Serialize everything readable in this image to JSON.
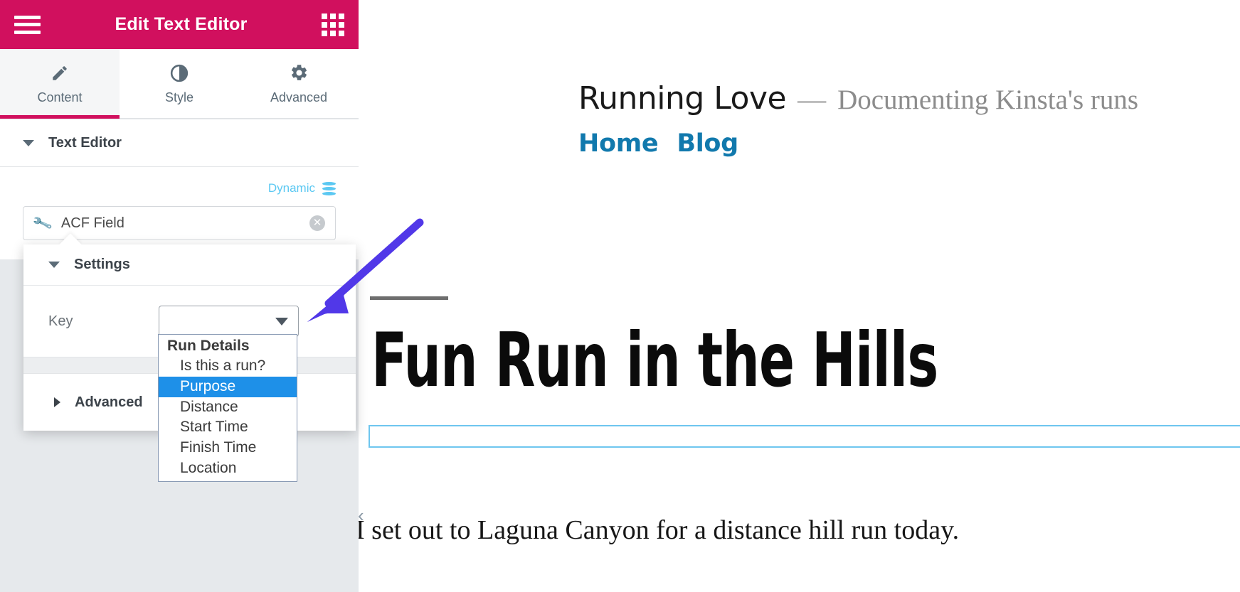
{
  "panel": {
    "header": {
      "title": "Edit Text Editor",
      "menu_icon": "hamburger-menu-icon",
      "apps_icon": "grid-apps-icon",
      "accent_color": "#d1105e"
    },
    "tabs": [
      {
        "label": "Content",
        "icon": "pencil-icon",
        "active": true
      },
      {
        "label": "Style",
        "icon": "contrast-circle-icon",
        "active": false
      },
      {
        "label": "Advanced",
        "icon": "gear-icon",
        "active": false
      }
    ],
    "sections": [
      {
        "label": "Text Editor",
        "expanded": true
      }
    ],
    "dynamic": {
      "label": "Dynamic",
      "icon": "database-stack-icon",
      "color": "#5bc8f2"
    },
    "acf_tag": {
      "label": "ACF Field",
      "icon": "wrench-icon",
      "clear_icon": "clear-circle-icon"
    },
    "popup": {
      "settings_label": "Settings",
      "key_label": "Key",
      "select_value": "",
      "select_caret_icon": "chevron-down-icon",
      "advanced_label": "Advanced"
    },
    "dropdown": {
      "group_label": "Run Details",
      "options": [
        {
          "label": "Is this a run?",
          "selected": false
        },
        {
          "label": "Purpose",
          "selected": true
        },
        {
          "label": "Distance",
          "selected": false
        },
        {
          "label": "Start Time",
          "selected": false
        },
        {
          "label": "Finish Time",
          "selected": false
        },
        {
          "label": "Location",
          "selected": false
        }
      ],
      "highlight_color": "#1e90e8"
    }
  },
  "preview": {
    "site_title": "Running Love",
    "site_dash": "—",
    "site_tagline": "Documenting Kinsta's runs",
    "nav": [
      {
        "label": "Home"
      },
      {
        "label": "Blog"
      }
    ],
    "nav_color": "#1179ad",
    "post_title": "Fun Run in the Hills",
    "post_body": "I set out to Laguna Canyon for a distance hill run today.",
    "collapse_handle_icon": "chevron-left-icon",
    "widget_outline_color": "#6ec6ef"
  },
  "annotation": {
    "arrow_icon": "pointer-arrow-icon",
    "color": "#5138e8"
  }
}
